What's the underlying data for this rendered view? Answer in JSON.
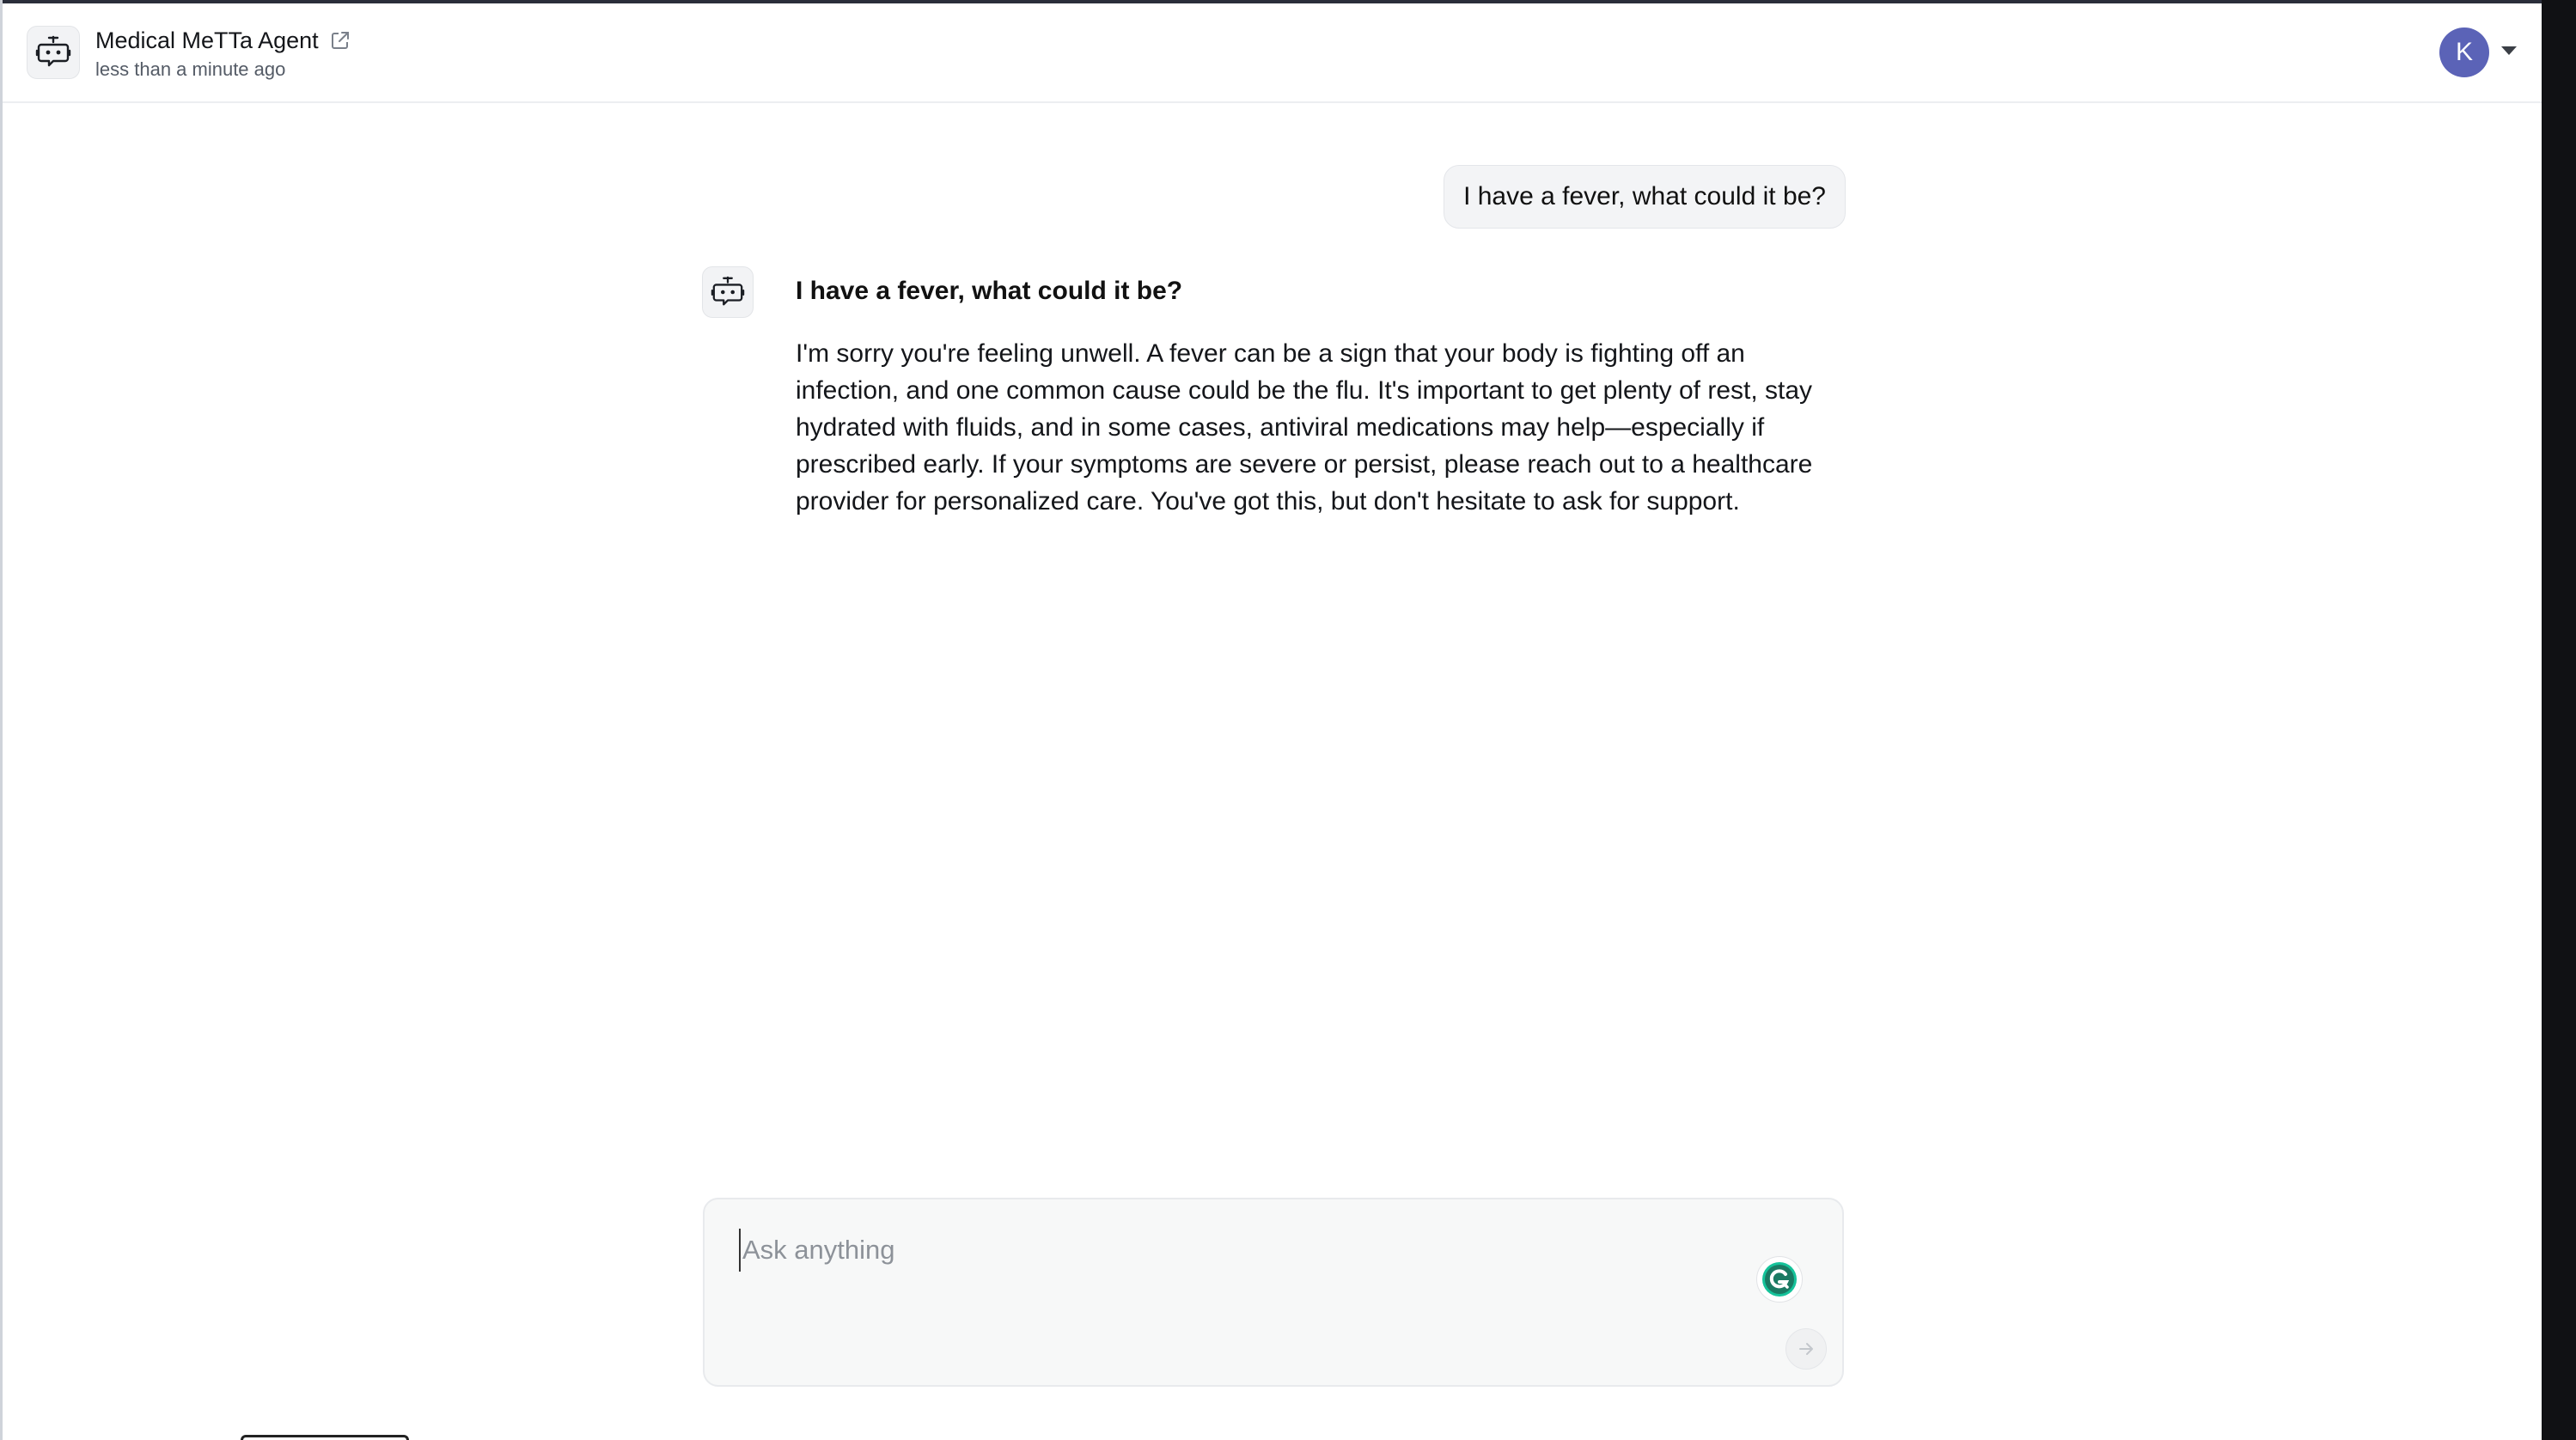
{
  "header": {
    "agent_name": "Medical MeTTa Agent",
    "agent_time": "less than a minute ago",
    "user_initial": "K"
  },
  "conversation": {
    "user_message": "I have a fever, what could it be?",
    "bot_title": "I have a fever, what could it be?",
    "bot_response": "I'm sorry you're feeling unwell. A fever can be a sign that your body is fighting off an infection, and one common cause could be the flu. It's important to get plenty of rest, stay hydrated with fluids, and in some cases, antiviral medications may help—especially if prescribed early. If your symptoms are severe or persist, please reach out to a healthcare provider for personalized care. You've got this, but don't hesitate to ask for support."
  },
  "composer": {
    "placeholder": "Ask anything",
    "value": ""
  },
  "icons": {
    "agent": "robot-icon",
    "external": "external-link-icon",
    "grammar": "grammarly-icon",
    "send": "arrow-right-icon",
    "caret": "chevron-down-icon"
  },
  "colors": {
    "user_avatar_bg": "#5b63b7",
    "grammar_green": "#15c39a",
    "bubble_bg": "#f3f4f6"
  }
}
